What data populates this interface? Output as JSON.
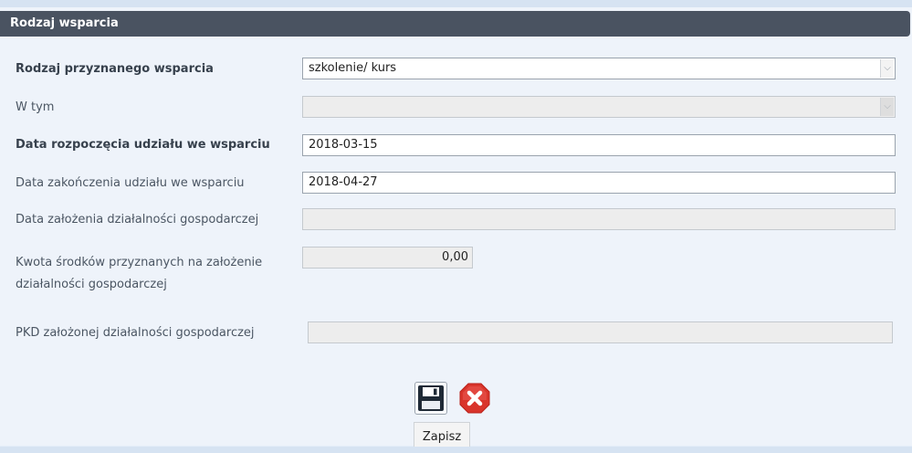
{
  "panel": {
    "title": "Rodzaj wsparcia"
  },
  "form": {
    "support_type": {
      "label": "Rodzaj przyznanego wsparcia",
      "value": "szkolenie/ kurs"
    },
    "including": {
      "label": "W tym",
      "value": ""
    },
    "start_date": {
      "label": "Data rozpoczęcia udziału we wsparciu",
      "value": "2018-03-15"
    },
    "end_date": {
      "label": "Data zakończenia udziału we wsparciu",
      "value": "2018-04-27"
    },
    "business_founding_date": {
      "label": "Data założenia działalności gospodarczej",
      "value": ""
    },
    "funds_amount": {
      "label_line1": "Kwota środków przyznanych na założenie",
      "label_line2": "działalności gospodarczej",
      "value": "0,00"
    },
    "pkd": {
      "label": "PKD założonej działalności gospodarczej",
      "value": ""
    }
  },
  "actions": {
    "save_tooltip": "Zapisz"
  },
  "icons": {
    "save": "floppy-disk-icon",
    "cancel": "red-cross-icon"
  },
  "colors": {
    "header_bg": "#4a5361",
    "panel_bg": "#eef3fa",
    "cancel_red": "#d9342b"
  }
}
